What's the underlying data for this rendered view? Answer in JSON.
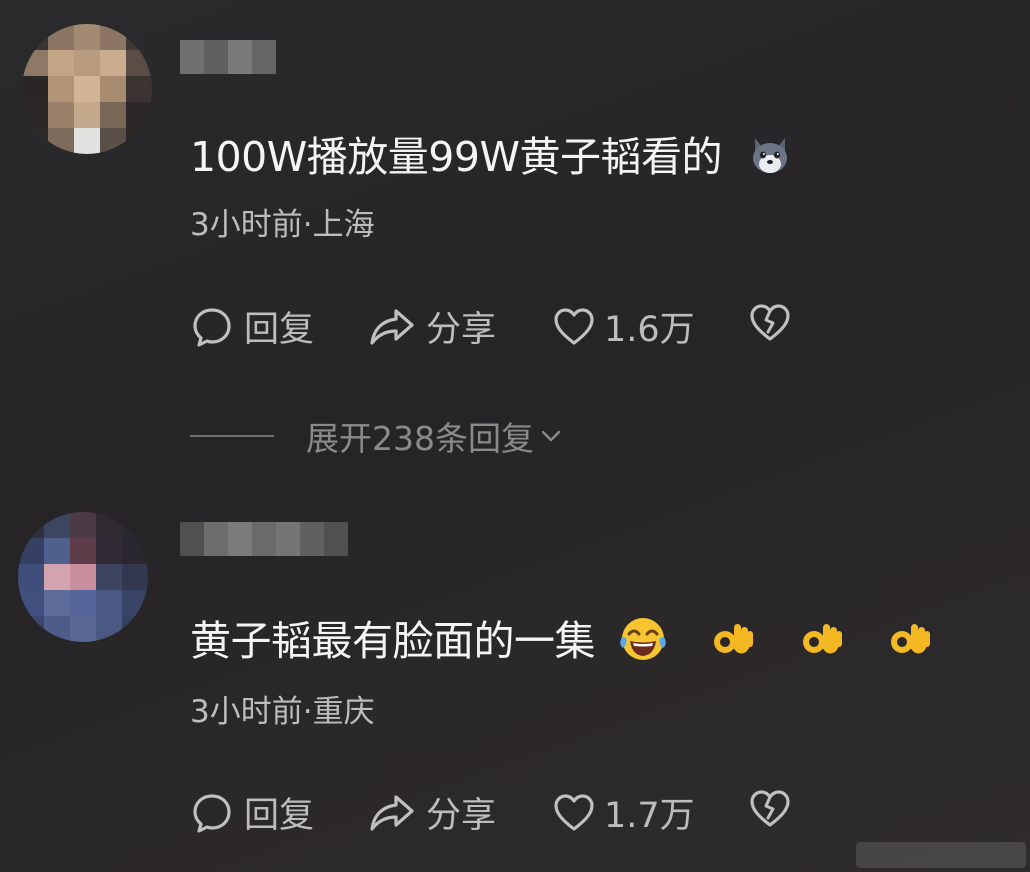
{
  "comments": [
    {
      "text": "100W播放量99W黄子韬看的",
      "emoji": "wolf-emoji",
      "meta": "3小时前·上海",
      "reply_label": "回复",
      "share_label": "分享",
      "like_count": "1.6万",
      "expand_label": "展开238条回复"
    },
    {
      "text": "黄子韬最有脸面的一集",
      "emoji": [
        "laughing-crying-emoji",
        "ok-hand-emoji",
        "ok-hand-emoji",
        "ok-hand-emoji"
      ],
      "meta": "3小时前·重庆",
      "reply_label": "回复",
      "share_label": "分享",
      "like_count": "1.7万"
    }
  ],
  "colors": {
    "background": "#272527",
    "primary_text": "#f4f4f4",
    "secondary_text": "#bdbdbd",
    "muted_text": "#8a8a8a"
  }
}
